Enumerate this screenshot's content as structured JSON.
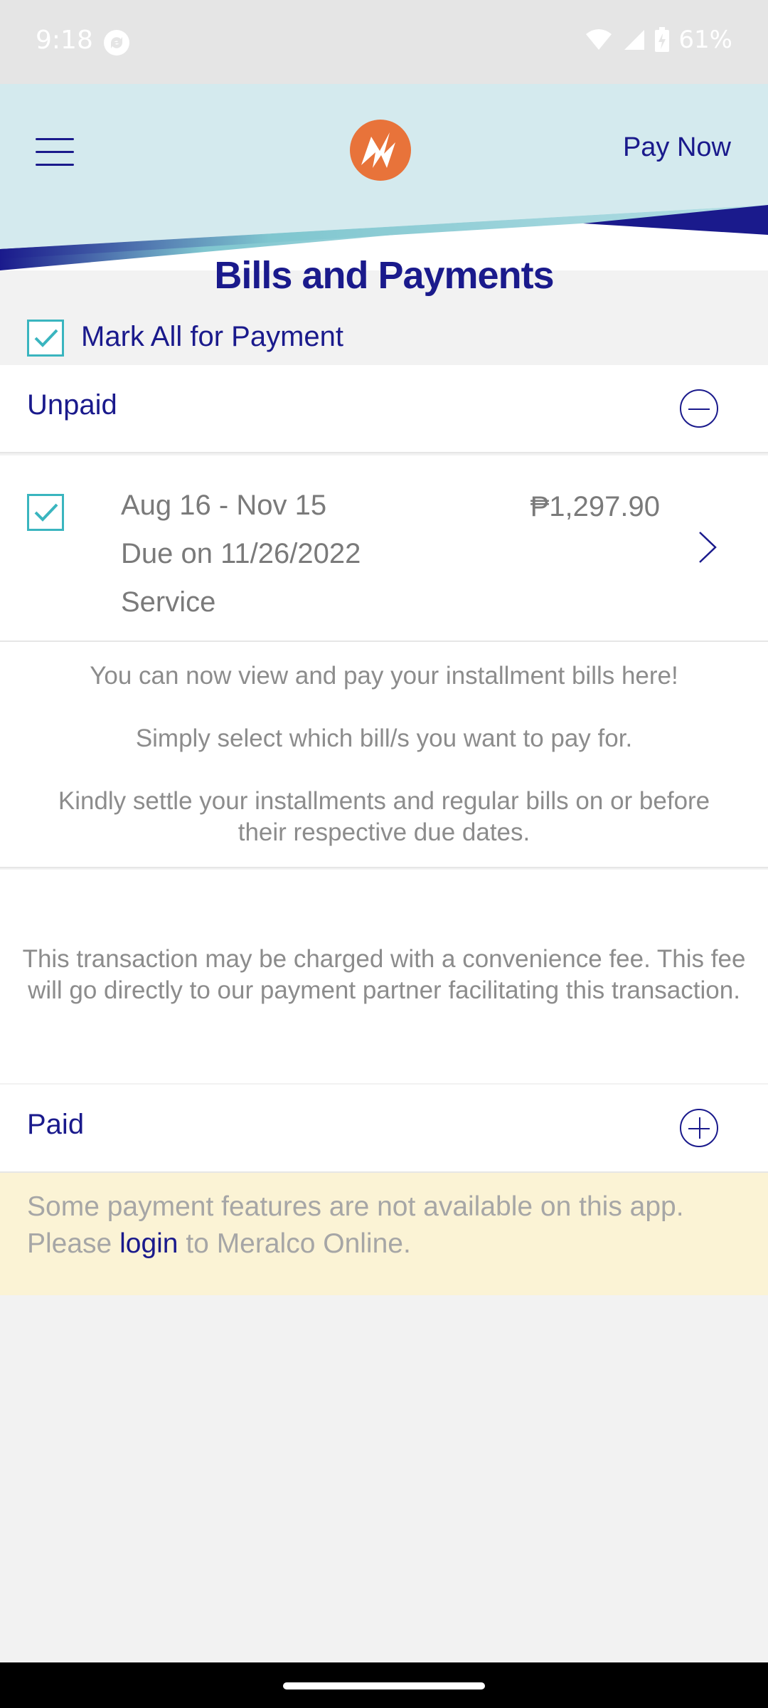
{
  "status_bar": {
    "time": "9:18",
    "battery": "61%",
    "icons": [
      "sync-icon",
      "wifi-icon",
      "signal-icon",
      "battery-icon"
    ]
  },
  "header": {
    "pay_now_label": "Pay Now",
    "logo_icon": "meralco-logo-icon",
    "menu_icon": "hamburger-menu-icon",
    "colors": {
      "navy": "#1a1a8c",
      "banner": "#d4eaee",
      "teal": "#7fc6cf",
      "orange": "#e8733a"
    }
  },
  "page_title": "Bills and Payments",
  "mark_all": {
    "label": "Mark All for Payment",
    "checked": true
  },
  "unpaid_section": {
    "title": "Unpaid",
    "toggle_icon": "collapse-minus-icon",
    "bills": [
      {
        "period": "Aug 16 - Nov 15",
        "due": "Due on 11/26/2022",
        "type": "Service",
        "amount": "₱1,297.90",
        "checked": true
      }
    ]
  },
  "info": {
    "line1": "You can now view and pay your installment bills here!",
    "line2": "Simply select which bill/s you want to pay for.",
    "line3": "Kindly settle your installments and regular bills on or before their respective due dates."
  },
  "fee_notice": "This transaction may be charged with a convenience fee. This fee will go directly to our payment partner facilitating this transaction.",
  "paid_section": {
    "title": "Paid",
    "toggle_icon": "expand-plus-icon"
  },
  "notice": {
    "before": "Some payment features are not available on this app. Please ",
    "link": "login",
    "after": " to Meralco Online."
  }
}
